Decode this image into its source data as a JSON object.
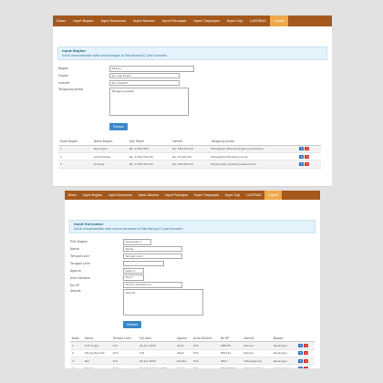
{
  "dept_page": {
    "nav": [
      "Home",
      "Input Bagian",
      "Input Karyawan",
      "Input Absensi",
      "Input Potongan",
      "Input Tunjangan",
      "Input Gaji",
      "LAPORAN",
      "Logout"
    ],
    "info_title": "Input Bagian",
    "info_text": "Untuk menambahkan data semua bagian di Toko Barang & Cake Sumadra",
    "form": {
      "labels": [
        "Bagian",
        "Gapok",
        "Insentif",
        "Tanggung Jawab"
      ],
      "values": [
        "Bagian",
        "Rp. Gaji Pokok",
        "Rp. Insentif",
        "Tanggung Jawab"
      ]
    },
    "submit": "Simpan",
    "table_headers": [
      "Kode Bagian",
      "Nama Bagian",
      "Gaji Pokok",
      "Insentif",
      "Tanggung Jawab",
      ""
    ],
    "rows": [
      [
        "1",
        "Keuangan",
        "Rp. 2.500.000",
        "Rp. 250.000,00",
        "Mengelola data keuangan perusahaan"
      ],
      [
        "2",
        "Administrasi",
        "Rp. 2.000.000,00",
        "Rp. 40.000,00",
        "Mengadministrasikan arsip"
      ],
      [
        "3",
        "Gudang",
        "Rp. 2.500.000,00",
        "Rp. 200.000,00",
        "Pengurusan gudang keseluruhan"
      ]
    ]
  },
  "emp_page": {
    "nav": [
      "Home",
      "Input Bagian",
      "Input Karyawan",
      "Input Absensi",
      "Input Potongan",
      "Input Tunjangan",
      "Input Gaji",
      "LAPORAN",
      "Logout"
    ],
    "info_title": "Input Karyawan",
    "info_text": "Untuk menambahkan data semua karyawan di Toko Barang & Cake Sumadra",
    "form": {
      "labels": [
        "Pilih Bagian",
        "Nama",
        "Tempat Lahir",
        "Tanggal Lahir",
        "Agama",
        "Jenis Kelamin",
        "No HP",
        "Alamat"
      ],
      "values": [
        "Keuangan",
        "Nama",
        "Tempat Lahir",
        "",
        "Islam",
        "Pria",
        "Nomor Handphone",
        "Alamat"
      ]
    },
    "submit": "Simpan",
    "table_headers": [
      "Kode",
      "Nama",
      "Tempat Lahir",
      "Tgl Lahir",
      "Agama",
      "Jenis Kelamin",
      "No HP",
      "Alamat",
      "Bagian",
      ""
    ],
    "rows": [
      [
        "1",
        "Priti Sugie",
        "Kdr",
        "26 Jun 2003",
        "Islam",
        "Pria",
        "088035",
        "Pesona",
        "Keuangan"
      ],
      [
        "2",
        "Dhyas Renaldi",
        "Kdri",
        "9-8",
        "Islam",
        "Pria",
        "081212",
        "Pesona",
        "Keuangan"
      ],
      [
        "3",
        "Nur",
        "Kdr",
        "26 Jun 2003",
        "Kristen",
        "Pria",
        "0812",
        "Tulungagung",
        "Keuangan"
      ],
      [
        "4",
        "Ericka",
        "Kediri",
        "20 September 1999",
        "Islam",
        "Pria",
        "081234567",
        "Tumpang Pasar",
        "Administrasi"
      ]
    ]
  }
}
